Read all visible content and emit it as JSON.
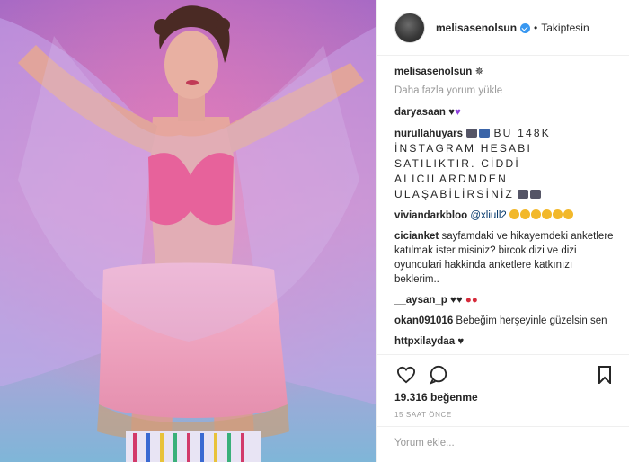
{
  "header": {
    "username": "melisasenolsun",
    "separator": "•",
    "follow_status": "Takiptesin"
  },
  "caption": {
    "username": "melisasenolsun",
    "emoji": "✵"
  },
  "load_more": "Daha fazla yorum yükle",
  "comments": [
    {
      "user": "daryasaan",
      "text": "♥",
      "extra": "💜"
    },
    {
      "user": "nurullahuyars",
      "text": "BU 148K İNSTAGRAM HESABI SATILIKTIR. CİDDİ ALICILARDMDEN ULAŞABİLİRSİNİZ"
    },
    {
      "user": "viviandarkbloo",
      "mention": "@xliull2"
    },
    {
      "user": "cicianket",
      "text": "sayfamdaki ve hikayemdeki anketlere katılmak ister misiniz? bircok dizi ve dizi oyunculari hakkinda anketlere katkınızı beklerim.."
    },
    {
      "user": "__aysan_p",
      "text": "♥♥"
    },
    {
      "user": "okan091016",
      "text": "Bebeğim herşeyinle güzelsin sen"
    },
    {
      "user": "httpxilaydaa",
      "text": "♥"
    }
  ],
  "likes": "19.316 beğenme",
  "time_ago": "15 SAAT ÖNCE",
  "add_comment_placeholder": "Yorum ekle...",
  "icons": [
    "heart-icon",
    "comment-icon",
    "bookmark-icon",
    "verified-icon"
  ],
  "colors": {
    "verified": "#3897f0",
    "muted": "#999999",
    "text": "#262626",
    "border": "#efefef"
  }
}
